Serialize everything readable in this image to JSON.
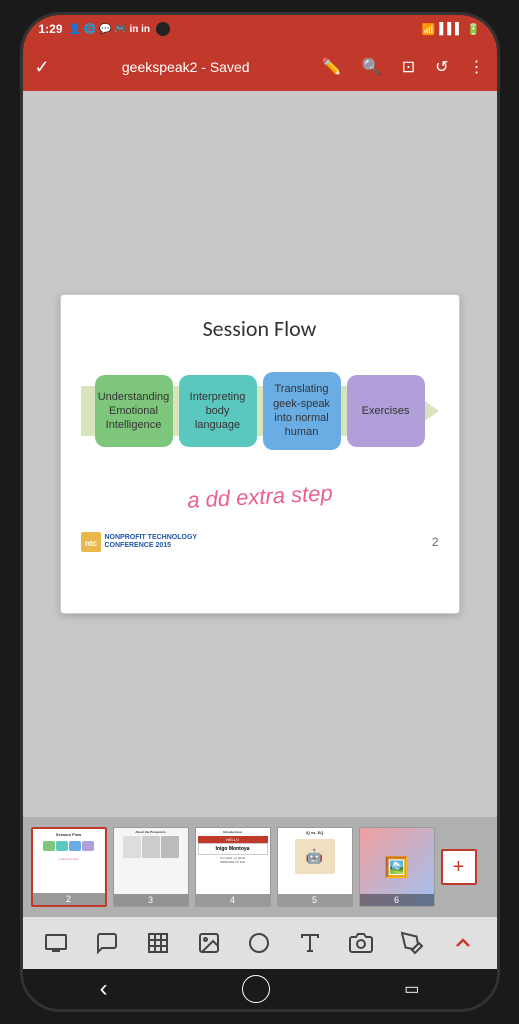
{
  "status_bar": {
    "time": "1:29",
    "title": "geekspeak2 - Saved",
    "wifi": "📶",
    "signal": "📡"
  },
  "toolbar": {
    "checkmark": "✓",
    "pen_label": "pen-icon",
    "search_label": "search-icon",
    "present_label": "present-icon",
    "undo_label": "undo-icon",
    "more_label": "more-icon",
    "title": "geekspeak2 - Saved"
  },
  "slide": {
    "title": "Session Flow",
    "boxes": [
      {
        "label": "Understanding Emotional Intelligence",
        "color": "green"
      },
      {
        "label": "Interpreting body language",
        "color": "teal"
      },
      {
        "label": "Translating geek-speak into normal human",
        "color": "blue"
      },
      {
        "label": "Exercises",
        "color": "purple"
      }
    ],
    "handwriting": "a dd extra step",
    "slide_number": "2"
  },
  "thumbnails": [
    {
      "number": "2",
      "active": true,
      "label": "Session Flow"
    },
    {
      "number": "3",
      "active": false,
      "label": "About the Presenters"
    },
    {
      "number": "4",
      "active": false,
      "label": "Introductions"
    },
    {
      "number": "5",
      "active": false,
      "label": "IQ vs. EQ"
    },
    {
      "number": "6",
      "active": false,
      "label": ""
    }
  ],
  "bottom_toolbar": {
    "icons": [
      "slides-icon",
      "comment-icon",
      "table-icon",
      "image-icon",
      "shape-icon",
      "text-icon",
      "camera-icon",
      "draw-icon",
      "arrow-up-icon"
    ]
  },
  "nav_bar": {
    "back": "‹",
    "home": "○",
    "recent": "▭"
  },
  "ntc": {
    "text": "NONPROFIT TECHNOLOGY\nCONFERENCE 2015"
  }
}
